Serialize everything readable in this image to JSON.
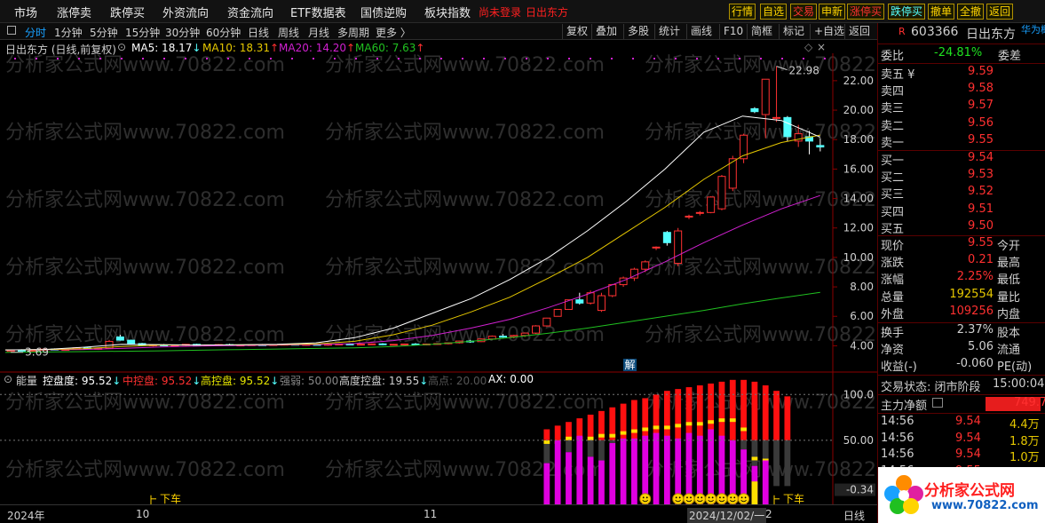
{
  "menu": {
    "left_items": [
      "市场",
      "涨停卖",
      "跌停买",
      "外资流向",
      "资金流向",
      "ETF数据表",
      "国债逆购",
      "板块指数"
    ],
    "status_left": "尚未登录",
    "status_right": "日出东方",
    "quick_buttons": [
      "行情",
      "自选",
      "交易",
      "申新",
      "涨停买",
      "跌停买",
      "撤单",
      "全撤",
      "返回"
    ]
  },
  "toolbar": {
    "periods": [
      "分时",
      "1分钟",
      "5分钟",
      "15分钟",
      "30分钟",
      "60分钟",
      "日线",
      "周线",
      "月线",
      "多周期",
      "更多 〉"
    ],
    "active_period": "分时",
    "buttons": [
      "复权",
      "叠加",
      "多股",
      "统计",
      "画线",
      "F10",
      "简框",
      "标记",
      "+自选",
      "返回"
    ]
  },
  "chart_header": {
    "stock": "日出东方 (日线,前复权)",
    "ma": [
      {
        "label": "MA5: 18.17",
        "color": "#ffffff",
        "arrow": "↓"
      },
      {
        "label": "MA10: 18.31",
        "color": "#e5c700",
        "arrow": "↑"
      },
      {
        "label": "MA20: 14.20",
        "color": "#d020d0",
        "arrow": "↑"
      },
      {
        "label": "MA60: 7.63",
        "color": "#20c020",
        "arrow": "↑"
      }
    ]
  },
  "indicator_header": {
    "name": "能量",
    "items": [
      {
        "label": "控盘度: 95.52",
        "color": "#ffffff",
        "arrow": "↓"
      },
      {
        "label": "中控盘: 95.52",
        "color": "#ff3030",
        "arrow": "↓"
      },
      {
        "label": "高控盘: 95.52",
        "color": "#e5e500",
        "arrow": "↓"
      },
      {
        "label": "强弱: 50.00",
        "color": "#888888",
        "arrow": ""
      },
      {
        "label": "高度控盘: 19.55",
        "color": "#d0d0d0",
        "arrow": "↓"
      },
      {
        "label": "高点: 20.00",
        "color": "#555555",
        "arrow": ""
      },
      {
        "label": "AX: 0.00",
        "color": "#ffffff",
        "arrow": ""
      }
    ]
  },
  "price_axis": [
    "22.00",
    "20.00",
    "18.00",
    "16.00",
    "14.00",
    "12.00",
    "10.00",
    "8.00",
    "6.00",
    "4.00"
  ],
  "indicator_axis": [
    "100.0",
    "50.00",
    "-0.34"
  ],
  "annotations": {
    "high_label": "22.98",
    "low_label": "3.69",
    "jie_badge": "解",
    "xiache_left": "下车",
    "xiache_right": "下车",
    "watermark": "分析家公式网www.70822.com"
  },
  "time_axis": [
    "2024年",
    "10",
    "11",
    "2024/12/02/一",
    "2",
    "日线"
  ],
  "quote": {
    "tag": "R",
    "code": "603366",
    "name": "日出东方",
    "corner": "华为概",
    "weibi_label": "委比",
    "weibi_value": "-24.81%",
    "weicha_label": "委差",
    "sell": [
      {
        "label": "卖五 ¥",
        "price": "9.59"
      },
      {
        "label": "卖四",
        "price": "9.58"
      },
      {
        "label": "卖三",
        "price": "9.57"
      },
      {
        "label": "卖二",
        "price": "9.56"
      },
      {
        "label": "卖一",
        "price": "9.55"
      }
    ],
    "buy": [
      {
        "label": "买一",
        "price": "9.54"
      },
      {
        "label": "买二",
        "price": "9.53"
      },
      {
        "label": "买三",
        "price": "9.52"
      },
      {
        "label": "买四",
        "price": "9.51"
      },
      {
        "label": "买五",
        "price": "9.50"
      }
    ],
    "stats": [
      {
        "l": "现价",
        "v": "9.55",
        "r": "今开"
      },
      {
        "l": "涨跌",
        "v": "0.21",
        "r": "最高"
      },
      {
        "l": "涨幅",
        "v": "2.25%",
        "r": "最低"
      },
      {
        "l": "总量",
        "v": "192554",
        "r": "量比",
        "vcolor": "#e5c700"
      },
      {
        "l": "外盘",
        "v": "109256",
        "r": "内盘"
      }
    ],
    "stats2": [
      {
        "l": "换手",
        "v": "2.37%",
        "r": "股本"
      },
      {
        "l": "净资",
        "v": "5.06",
        "r": "流通"
      },
      {
        "l": "收益(-)",
        "v": "-0.060",
        "r": "PE(动)"
      }
    ],
    "trade_status": "交易状态: 闭市阶段",
    "trade_time": "15:00:04",
    "main_net_label": "主力净额",
    "main_net_value": "749.7",
    "ticks": [
      {
        "t": "14:56",
        "p": "9.54",
        "v": "4.4万"
      },
      {
        "t": "14:56",
        "p": "9.54",
        "v": "1.8万"
      },
      {
        "t": "14:56",
        "p": "9.54",
        "v": "1.0万"
      },
      {
        "t": "14:56",
        "p": "9.55",
        "v": "1.9万"
      }
    ],
    "logo_text": "分析家公式网",
    "logo_url": "www.70822.com"
  },
  "colors": {
    "up": "#ff3232",
    "down": "#54ffff",
    "ma5": "#ffffff",
    "ma10": "#e5c700",
    "ma20": "#d020d0",
    "ma60": "#20c020"
  },
  "chart_data": {
    "type": "candlestick",
    "title": "日出东方 (日线,前复权)",
    "y_range": [
      3.0,
      23.5
    ],
    "candles": [
      {
        "o": 3.62,
        "h": 3.74,
        "l": 3.56,
        "c": 3.7
      },
      {
        "o": 3.7,
        "h": 3.76,
        "l": 3.64,
        "c": 3.66
      },
      {
        "o": 3.66,
        "h": 3.72,
        "l": 3.6,
        "c": 3.7
      },
      {
        "o": 3.7,
        "h": 3.8,
        "l": 3.66,
        "c": 3.77
      },
      {
        "o": 3.77,
        "h": 3.82,
        "l": 3.7,
        "c": 3.73
      },
      {
        "o": 3.73,
        "h": 3.79,
        "l": 3.67,
        "c": 3.75
      },
      {
        "o": 3.75,
        "h": 3.9,
        "l": 3.72,
        "c": 3.86
      },
      {
        "o": 3.86,
        "h": 3.9,
        "l": 3.76,
        "c": 3.79
      },
      {
        "o": 3.79,
        "h": 3.85,
        "l": 3.72,
        "c": 3.82
      },
      {
        "o": 3.82,
        "h": 4.4,
        "l": 3.8,
        "c": 4.3
      },
      {
        "o": 4.6,
        "h": 4.75,
        "l": 4.35,
        "c": 4.38
      },
      {
        "o": 4.38,
        "h": 4.42,
        "l": 4.1,
        "c": 4.15
      },
      {
        "o": 4.15,
        "h": 4.2,
        "l": 3.98,
        "c": 4.02
      },
      {
        "o": 4.02,
        "h": 4.1,
        "l": 3.95,
        "c": 4.06
      },
      {
        "o": 4.06,
        "h": 4.12,
        "l": 3.98,
        "c": 4.02
      },
      {
        "o": 4.02,
        "h": 4.08,
        "l": 3.96,
        "c": 4.04
      },
      {
        "o": 4.04,
        "h": 4.12,
        "l": 4.0,
        "c": 4.1
      },
      {
        "o": 4.1,
        "h": 4.14,
        "l": 4.0,
        "c": 4.03
      },
      {
        "o": 4.03,
        "h": 4.09,
        "l": 3.98,
        "c": 4.06
      },
      {
        "o": 4.06,
        "h": 4.12,
        "l": 4.02,
        "c": 4.08
      },
      {
        "o": 4.08,
        "h": 4.14,
        "l": 4.0,
        "c": 4.02
      },
      {
        "o": 4.02,
        "h": 4.08,
        "l": 3.96,
        "c": 4.05
      },
      {
        "o": 4.05,
        "h": 4.1,
        "l": 4.0,
        "c": 4.07
      },
      {
        "o": 4.07,
        "h": 4.12,
        "l": 4.02,
        "c": 4.04
      },
      {
        "o": 4.04,
        "h": 4.1,
        "l": 4.0,
        "c": 4.08
      },
      {
        "o": 4.08,
        "h": 4.14,
        "l": 4.02,
        "c": 4.1
      },
      {
        "o": 4.1,
        "h": 4.16,
        "l": 4.04,
        "c": 4.06
      },
      {
        "o": 4.06,
        "h": 4.12,
        "l": 4.0,
        "c": 4.09
      },
      {
        "o": 4.09,
        "h": 4.14,
        "l": 4.04,
        "c": 4.06
      },
      {
        "o": 4.06,
        "h": 4.12,
        "l": 4.0,
        "c": 4.1
      },
      {
        "o": 4.1,
        "h": 4.16,
        "l": 4.06,
        "c": 4.12
      },
      {
        "o": 4.12,
        "h": 4.18,
        "l": 4.06,
        "c": 4.08
      },
      {
        "o": 4.08,
        "h": 4.14,
        "l": 4.02,
        "c": 4.11
      },
      {
        "o": 4.11,
        "h": 4.16,
        "l": 4.06,
        "c": 4.13
      },
      {
        "o": 4.13,
        "h": 4.18,
        "l": 4.04,
        "c": 4.07
      },
      {
        "o": 4.07,
        "h": 4.12,
        "l": 4.02,
        "c": 4.1
      },
      {
        "o": 4.1,
        "h": 4.15,
        "l": 4.05,
        "c": 4.12
      },
      {
        "o": 4.12,
        "h": 4.18,
        "l": 4.06,
        "c": 4.09
      },
      {
        "o": 4.09,
        "h": 4.15,
        "l": 4.03,
        "c": 4.12
      },
      {
        "o": 4.12,
        "h": 4.18,
        "l": 4.07,
        "c": 4.15
      },
      {
        "o": 4.15,
        "h": 4.22,
        "l": 4.1,
        "c": 4.2
      },
      {
        "o": 4.2,
        "h": 4.35,
        "l": 4.15,
        "c": 4.32
      },
      {
        "o": 4.32,
        "h": 4.4,
        "l": 4.2,
        "c": 4.28
      },
      {
        "o": 4.28,
        "h": 4.5,
        "l": 4.25,
        "c": 4.46
      },
      {
        "o": 4.46,
        "h": 4.7,
        "l": 4.4,
        "c": 4.65
      },
      {
        "o": 4.65,
        "h": 4.8,
        "l": 4.55,
        "c": 4.62
      },
      {
        "o": 4.62,
        "h": 4.75,
        "l": 4.5,
        "c": 4.7
      },
      {
        "o": 4.7,
        "h": 4.9,
        "l": 4.6,
        "c": 4.86
      },
      {
        "o": 4.86,
        "h": 5.4,
        "l": 4.8,
        "c": 5.35
      },
      {
        "o": 5.35,
        "h": 5.9,
        "l": 5.3,
        "c": 5.88
      },
      {
        "o": 6.0,
        "h": 6.5,
        "l": 6.0,
        "c": 6.47
      },
      {
        "o": 6.47,
        "h": 7.12,
        "l": 6.47,
        "c": 7.12
      },
      {
        "o": 7.12,
        "h": 7.6,
        "l": 6.8,
        "c": 6.9
      },
      {
        "o": 6.9,
        "h": 7.75,
        "l": 6.8,
        "c": 7.6
      },
      {
        "o": 6.4,
        "h": 7.6,
        "l": 6.3,
        "c": 7.4
      },
      {
        "o": 7.4,
        "h": 8.2,
        "l": 7.3,
        "c": 8.15
      },
      {
        "o": 8.15,
        "h": 8.7,
        "l": 8.0,
        "c": 8.6
      },
      {
        "o": 8.6,
        "h": 9.3,
        "l": 8.4,
        "c": 9.2
      },
      {
        "o": 9.2,
        "h": 9.8,
        "l": 9.0,
        "c": 9.7
      },
      {
        "o": 10.65,
        "h": 10.75,
        "l": 10.5,
        "c": 10.7
      },
      {
        "o": 11.7,
        "h": 11.8,
        "l": 10.8,
        "c": 11.0
      },
      {
        "o": 9.6,
        "h": 12.0,
        "l": 9.4,
        "c": 11.8
      },
      {
        "o": 12.8,
        "h": 12.9,
        "l": 12.6,
        "c": 12.8
      },
      {
        "o": 13.0,
        "h": 13.15,
        "l": 12.85,
        "c": 13.05
      },
      {
        "o": 13.05,
        "h": 14.15,
        "l": 13.0,
        "c": 14.1
      },
      {
        "o": 13.3,
        "h": 15.6,
        "l": 13.2,
        "c": 15.5
      },
      {
        "o": 14.7,
        "h": 16.9,
        "l": 14.5,
        "c": 16.7
      },
      {
        "o": 16.7,
        "h": 18.4,
        "l": 16.4,
        "c": 18.3
      },
      {
        "o": 20.1,
        "h": 20.2,
        "l": 19.8,
        "c": 19.9
      },
      {
        "o": 19.7,
        "h": 22.1,
        "l": 18.1,
        "c": 22.1
      },
      {
        "o": 19.5,
        "h": 22.98,
        "l": 19.2,
        "c": 19.5
      },
      {
        "o": 19.5,
        "h": 19.6,
        "l": 17.9,
        "c": 18.2
      },
      {
        "o": 17.9,
        "h": 19.0,
        "l": 17.5,
        "c": 18.4
      },
      {
        "o": 18.2,
        "h": 18.6,
        "l": 17.0,
        "c": 17.9
      },
      {
        "o": 17.6,
        "h": 18.1,
        "l": 17.2,
        "c": 17.5
      }
    ],
    "ma5": [
      3.72,
      3.75,
      3.9,
      4.1,
      4.08,
      4.05,
      4.07,
      4.1,
      4.2,
      4.55,
      5.2,
      6.2,
      7.2,
      8.5,
      10.0,
      11.8,
      13.8,
      16.0,
      18.5,
      19.6,
      19.3,
      18.17
    ],
    "ma10": [
      3.72,
      3.74,
      3.8,
      3.95,
      4.05,
      4.05,
      4.06,
      4.08,
      4.12,
      4.3,
      4.75,
      5.4,
      6.3,
      7.3,
      8.6,
      10.0,
      11.7,
      13.4,
      15.3,
      16.9,
      17.8,
      18.31
    ],
    "ma20": [
      3.72,
      3.73,
      3.75,
      3.82,
      3.92,
      3.98,
      4.02,
      4.05,
      4.08,
      4.15,
      4.35,
      4.7,
      5.2,
      5.8,
      6.6,
      7.5,
      8.5,
      9.7,
      11.0,
      12.2,
      13.3,
      14.2
    ],
    "ma60": [
      3.55,
      3.58,
      3.6,
      3.63,
      3.66,
      3.7,
      3.74,
      3.78,
      3.82,
      3.86,
      3.95,
      4.1,
      4.3,
      4.55,
      4.85,
      5.2,
      5.6,
      6.0,
      6.4,
      6.85,
      7.25,
      7.63
    ],
    "indicator": {
      "red_top": [
        0,
        0,
        0,
        0,
        0,
        0,
        0,
        0,
        0,
        0,
        0,
        0,
        0,
        0,
        0,
        0,
        0,
        0,
        0,
        0,
        0,
        0,
        0,
        0,
        0,
        0,
        0,
        0,
        0,
        0,
        0,
        0,
        0,
        0,
        0,
        0,
        0,
        0,
        0,
        0,
        0,
        0,
        0,
        0,
        0,
        0,
        0,
        0,
        0,
        0,
        0,
        0,
        0,
        0,
        0,
        0,
        0,
        0,
        0,
        0,
        0,
        0,
        0,
        0,
        0,
        0,
        0,
        0,
        0,
        0,
        0,
        0,
        0,
        0,
        0,
        0,
        0
      ],
      "bars": [
        {
          "top": 62,
          "yellow": 48,
          "mag": 25
        },
        {
          "top": 66,
          "yellow": 48,
          "mag": 50
        },
        {
          "top": 70,
          "yellow": 52,
          "mag": 37
        },
        {
          "top": 74,
          "yellow": 52,
          "mag": 55
        },
        {
          "top": 78,
          "yellow": 52,
          "mag": 32
        },
        {
          "top": 82,
          "yellow": 55,
          "mag": 28
        },
        {
          "top": 86,
          "yellow": 55,
          "mag": 47
        },
        {
          "top": 90,
          "yellow": 58,
          "mag": 52
        },
        {
          "top": 94,
          "yellow": 60,
          "mag": 52
        },
        {
          "top": 96,
          "yellow": 62,
          "mag": 55
        },
        {
          "top": 100,
          "yellow": 64,
          "mag": 58
        },
        {
          "top": 104,
          "yellow": 64,
          "mag": 55
        },
        {
          "top": 106,
          "yellow": 66,
          "mag": 52
        },
        {
          "top": 108,
          "yellow": 68,
          "mag": 58
        },
        {
          "top": 110,
          "yellow": 68,
          "mag": 55
        },
        {
          "top": 112,
          "yellow": 70,
          "mag": 62
        },
        {
          "top": 114,
          "yellow": 72,
          "mag": 55
        },
        {
          "top": 116,
          "yellow": 72,
          "mag": 50
        },
        {
          "top": 116,
          "yellow": 62,
          "mag": 40
        },
        {
          "top": 114,
          "yellow": 30,
          "mag": 22
        },
        {
          "top": 110,
          "yellow": 28,
          "mag": 28
        },
        {
          "top": 104,
          "yellow": 0,
          "mag": 0
        },
        {
          "top": 98,
          "yellow": 0,
          "mag": 0
        }
      ]
    },
    "smiley_indices": [
      9,
      12,
      13,
      14,
      15,
      16,
      17,
      18
    ]
  }
}
